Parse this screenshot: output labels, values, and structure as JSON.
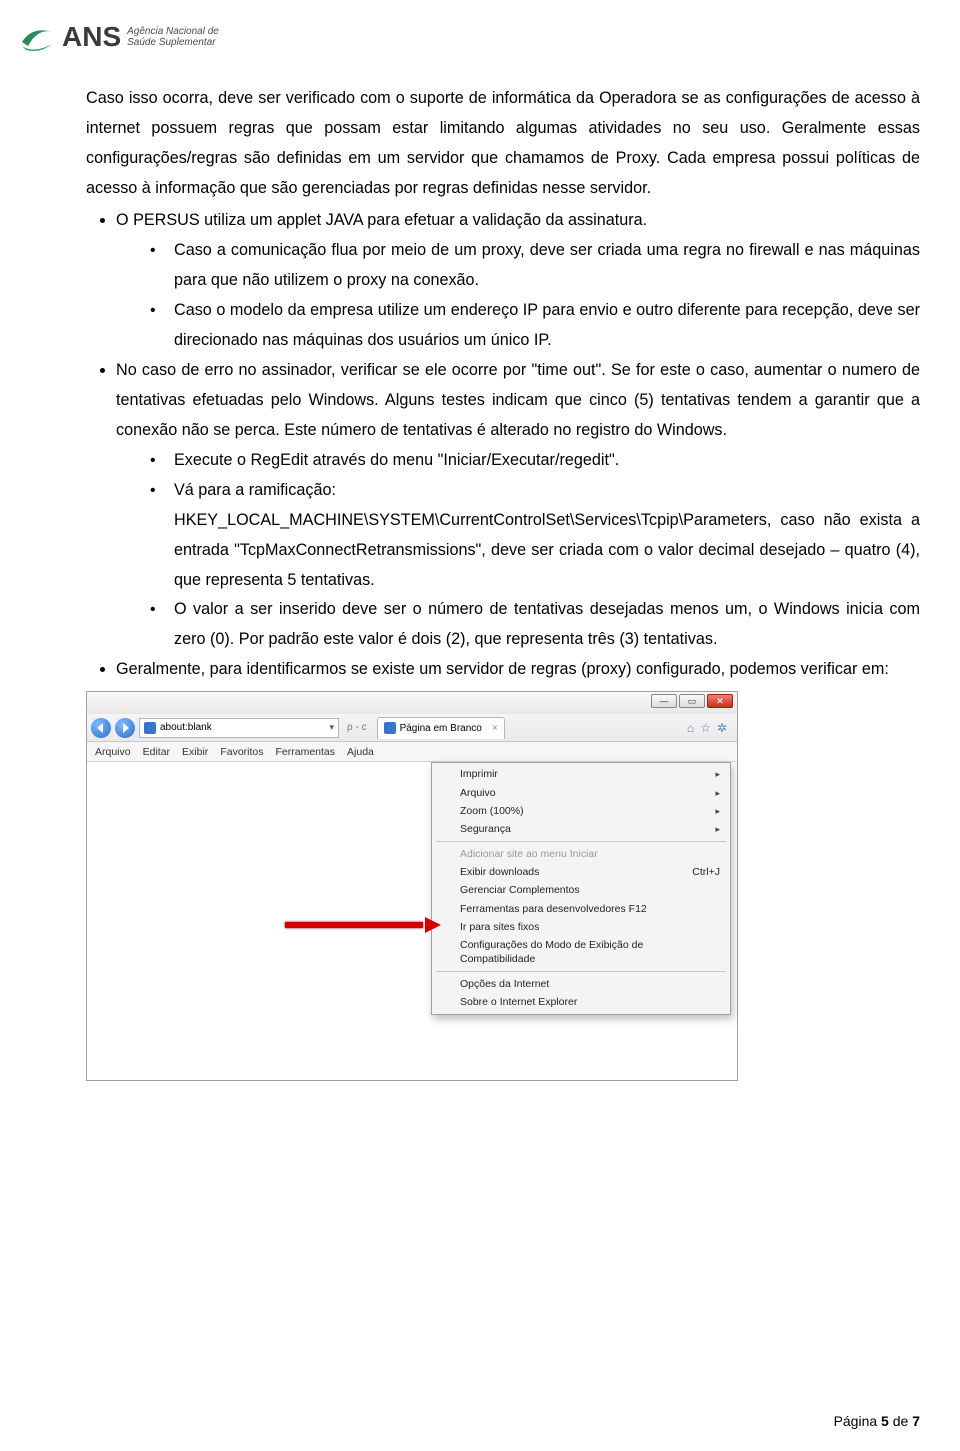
{
  "header": {
    "logo_abbr": "ANS",
    "logo_sub_line1": "Agência Nacional de",
    "logo_sub_line2": "Saúde Suplementar"
  },
  "content": {
    "intro_para": "Caso isso ocorra, deve ser verificado com o suporte de informática da Operadora se as configurações de acesso à internet possuem regras que possam estar limitando algumas atividades no seu uso. Geralmente essas configurações/regras são definidas em um servidor que chamamos de Proxy. Cada empresa possui políticas de acesso à informação que são gerenciadas por regras definidas nesse servidor.",
    "bullets": {
      "b1": "O PERSUS utiliza um applet JAVA para efetuar a validação da assinatura.",
      "b1_sub1": "Caso a comunicação flua por meio de um proxy, deve ser criada uma regra no firewall e nas máquinas para que não utilizem o proxy na conexão.",
      "b1_sub2": "Caso o modelo da empresa utilize um endereço IP para envio e outro diferente para recepção, deve ser direcionado nas máquinas dos usuários um único IP.",
      "b2": "No caso de erro no assinador, verificar se ele ocorre por \"time out\". Se for este o caso, aumentar o numero de tentativas efetuadas pelo Windows. Alguns testes indicam que cinco (5) tentativas tendem a garantir que a conexão não se perca. Este número de tentativas é alterado no registro do Windows.",
      "b2_sub1": "Execute o RegEdit através do menu \"Iniciar/Executar/regedit\".",
      "b2_sub2_lead": "Vá para a ramificação:",
      "b2_sub2_path": "HKEY_LOCAL_MACHINE\\SYSTEM\\CurrentControlSet\\Services\\Tcpip\\Parameters, caso não exista a entrada \"TcpMaxConnectRetransmissions\", deve ser criada com o valor decimal desejado – quatro (4), que representa 5 tentativas.",
      "b2_sub3": "O valor a ser inserido deve ser o número de tentativas desejadas menos um, o Windows inicia com zero (0). Por padrão este valor é dois (2), que representa três (3) tentativas.",
      "b3": "Geralmente, para identificarmos se existe um servidor de regras (proxy) configurado, podemos verificar em:"
    }
  },
  "ie": {
    "addr_url": "about:blank",
    "search_hint": "ρ - c",
    "tab_title": "Página em Branco",
    "menubar": [
      "Arquivo",
      "Editar",
      "Exibir",
      "Favoritos",
      "Ferramentas",
      "Ajuda"
    ],
    "win_min": "—",
    "win_max": "▭",
    "win_close": "✕",
    "tool_home": "⌂",
    "tool_fav": "☆",
    "tool_gear": "✲",
    "context_menu": [
      {
        "label": "Imprimir",
        "arrow": true
      },
      {
        "label": "Arquivo",
        "arrow": true
      },
      {
        "label": "Zoom (100%)",
        "arrow": true
      },
      {
        "label": "Segurança",
        "arrow": true
      },
      {
        "sep": true
      },
      {
        "label": "Adicionar site ao menu Iniciar",
        "disabled": true
      },
      {
        "label": "Exibir downloads",
        "shortcut": "Ctrl+J"
      },
      {
        "label": "Gerenciar Complementos"
      },
      {
        "label": "Ferramentas para desenvolvedores F12"
      },
      {
        "label": "Ir para sites fixos"
      },
      {
        "label": "Configurações do Modo de Exibição de Compatibilidade"
      },
      {
        "sep": true
      },
      {
        "label": "Opções da Internet"
      },
      {
        "label": "Sobre o Internet Explorer"
      }
    ]
  },
  "footer": {
    "prefix": "Página ",
    "current": "5",
    "sep": " de ",
    "total": "7"
  }
}
